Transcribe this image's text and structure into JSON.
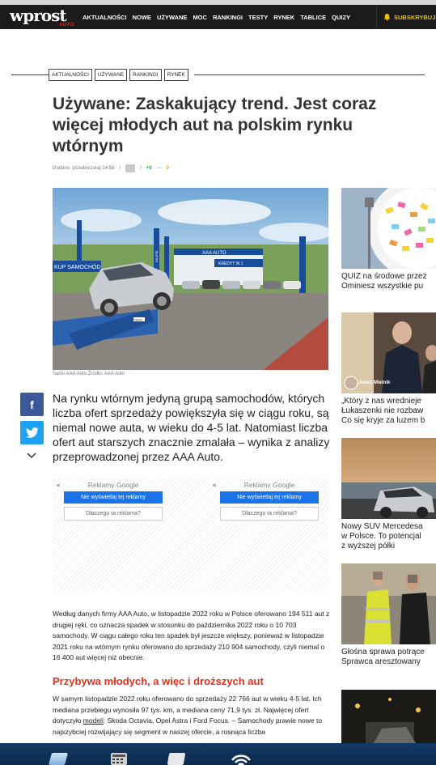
{
  "header": {
    "logo": "wprost",
    "logo_sub": "AUTO",
    "nav": [
      "AKTUALNOŚCI",
      "NOWE",
      "UŻYWANE",
      "MOC",
      "RANKINGI",
      "TESTY",
      "RYNEK",
      "TABLICE",
      "QUIZY"
    ],
    "subscribe": "SUBSKRYBUJ"
  },
  "article": {
    "tags": [
      "AKTUALNOŚCI",
      "UŻYWANE",
      "RANKINGI",
      "RYNEK"
    ],
    "title": "Używane: Zaskakujący trend. Jest coraz więcej młodych aut na polskim rynku wtórnym",
    "meta": {
      "added": "Dodano: przedwczoraj 14:58",
      "comments": "0",
      "plus": "+0",
      "minus": "0"
    },
    "photo_caption": "Salon AAA Auto Źródło: AAA Auto",
    "photo_text": {
      "banner": "AAA AUTO",
      "sign_left": "KUP SAMOCHÓD",
      "sign_right": "KREDYT W 1",
      "flag_text": "SKUPIE",
      "plate": "GWH"
    },
    "lead": "Na rynku wtórnym jedyną grupą samochodów, których liczba ofert sprzedaży powiększyła się w ciągu roku, są niemal nowe auta, w wieku do 4-5 lat. Natomiast liczba ofert aut starszych znacznie zmalała – wynika z analizy przeprowadzonej przez AAA Auto.",
    "ads": [
      {
        "label": "Reklamy Google",
        "btn": "Nie wyświetlaj tej reklamy",
        "why": "Dlaczego ta reklama?"
      },
      {
        "label": "Reklamy Google",
        "btn": "Nie wyświetlaj tej reklamy",
        "why": "Dlaczego ta reklama?"
      }
    ],
    "paragraph1": "Według danych firmy AAA Auto, w listopadzie 2022 roku w Polsce oferowano 194 511 aut z drugiej ręki, co oznacza spadek w stosunku do października 2022 roku o 10 703 samochody. W ciągu całego roku ten spadek był jeszcze większy, ponieważ w listopadzie 2021 roku na wtórnym rynku oferowano do sprzedaży 210 904 samochody, czyli niemal o 16 400 aut więcej niż obecnie.",
    "subheading": "Przybywa młodych, a więc i droższych aut",
    "paragraph2_a": "W samym listopadzie 2022 roku oferowano do sprzedaży 22 766 aut w wieku 4-5 lat. Ich mediana przebiegu wynosiła 97 tys. km, a mediana ceny 71,9 tys. zł. Najwięcej ofert dotyczyło ",
    "paragraph2_link": "modeli",
    "paragraph2_b": ": Skoda Octavia, Opel Astra i Ford Focus. – Samochody prawie nowe to najszybciej rozwijający się segment w naszej ofercie, a rosnąca liczba"
  },
  "sidebar": [
    {
      "title_1": "QUIZ na środowe przez",
      "title_2": "Ominiesz wszystkie pu"
    },
    {
      "author": "Jakub Mielnik",
      "title_1": "„Który z nas wrednieje",
      "title_2": "Łukaszenki nie rozbaw",
      "title_3": "Co się kryje za luzem b"
    },
    {
      "title_1": "Nowy SUV Mercedesa",
      "title_2": "w Polsce. To potencjal",
      "title_3": "z wyższej półki"
    },
    {
      "title_1": "Głośna sprawa potrące",
      "title_2": "Sprawca aresztowany"
    }
  ]
}
